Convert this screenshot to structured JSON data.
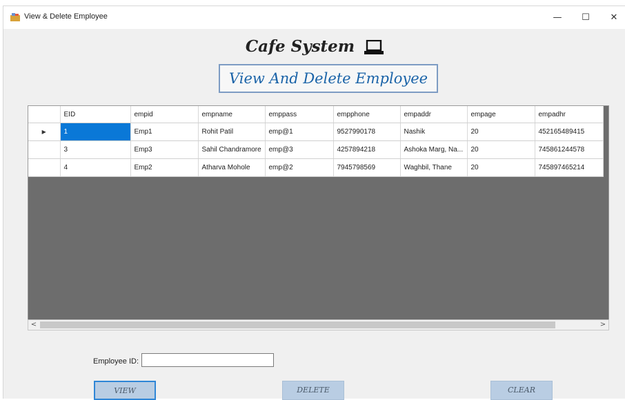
{
  "window": {
    "title": "View & Delete Employee",
    "minimize": "—",
    "maximize": "☐",
    "close": "✕"
  },
  "header": {
    "title": "Cafe System",
    "subtitle": "View And Delete Employee"
  },
  "grid": {
    "columns": [
      "EID",
      "empid",
      "empname",
      "emppass",
      "empphone",
      "empaddr",
      "empage",
      "empadhr"
    ],
    "rows": [
      [
        "1",
        "Emp1",
        "Rohit Patil",
        "emp@1",
        "9527990178",
        "Nashik",
        "20",
        "452165489415"
      ],
      [
        "3",
        "Emp3",
        "Sahil Chandramore",
        "emp@3",
        "4257894218",
        "Ashoka Marg, Na...",
        "20",
        "745861244578"
      ],
      [
        "4",
        "Emp2",
        "Atharva Mohole",
        "emp@2",
        "7945798569",
        "Waghbil, Thane",
        "20",
        "745897465214"
      ]
    ],
    "current_row_marker": "▶",
    "scroll_left": "<",
    "scroll_right": ">"
  },
  "form": {
    "employee_id_label": "Employee ID:",
    "employee_id_value": ""
  },
  "buttons": {
    "view": "VIEW",
    "delete": "DELETE",
    "clear": "CLEAR"
  },
  "colors": {
    "accent": "#1a63a8",
    "selection": "#0a78d7",
    "button": "#b9cde3"
  }
}
